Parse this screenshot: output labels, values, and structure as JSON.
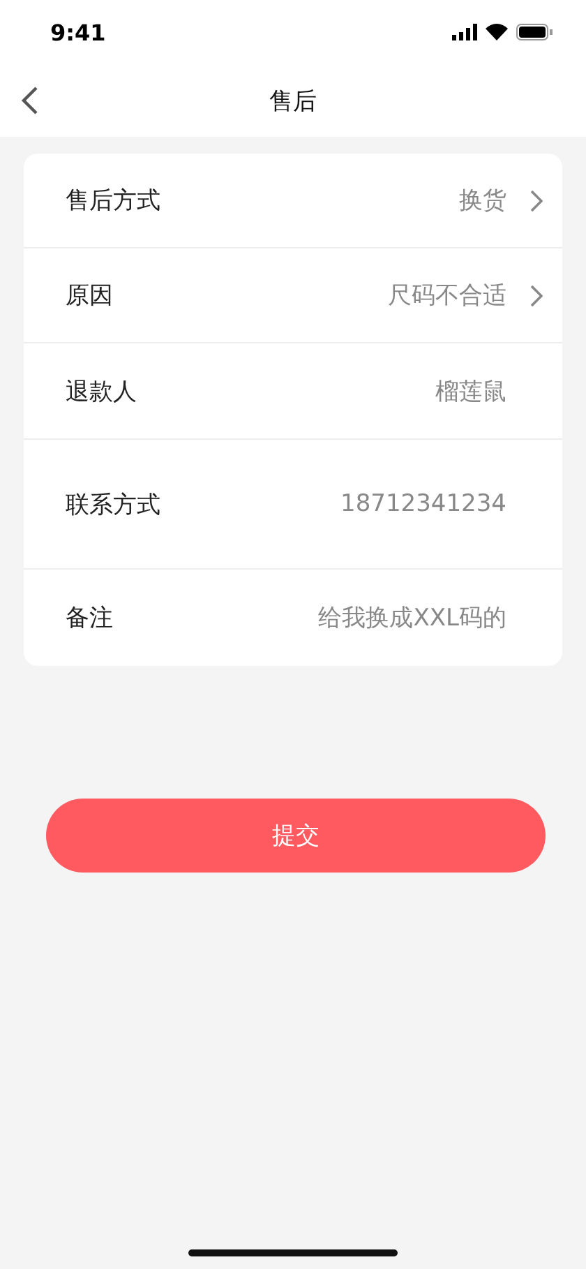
{
  "status_bar": {
    "time": "9:41"
  },
  "nav": {
    "title": "售后"
  },
  "form": [
    {
      "label": "售后方式",
      "value": "换货",
      "kind": "select"
    },
    {
      "label": "原因",
      "value": "尺码不合适",
      "kind": "select"
    },
    {
      "label": "退款人",
      "value": "榴莲鼠",
      "kind": "text"
    },
    {
      "label": "联系方式",
      "value": "18712341234",
      "kind": "tall"
    },
    {
      "label": "备注",
      "value": "给我换成XXL码的",
      "kind": "text"
    }
  ],
  "submit": {
    "label": "提交"
  }
}
